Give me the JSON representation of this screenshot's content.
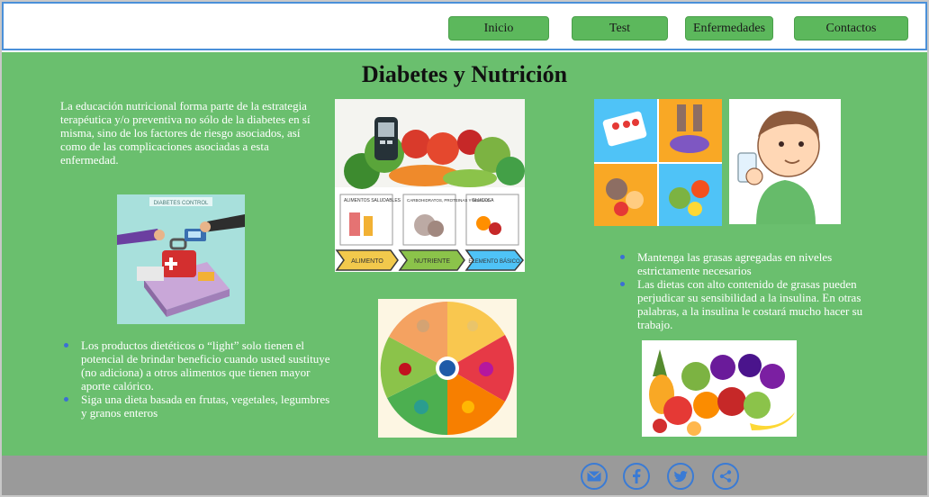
{
  "nav": {
    "items": [
      "Inicio",
      "Test",
      "Enfermedades",
      "Contactos"
    ]
  },
  "main": {
    "title": "Diabetes y Nutrición",
    "intro": "La educación nutricional forma  parte de la estrategia terapéutica y/o preventiva no sólo de la diabetes en sí misma, sino de los factores de riesgo asociados, así como de las complicaciones  asociadas a esta enfermedad.",
    "left_bullets": [
      "Los productos dietéticos o “light” solo tienen el potencial de brindar beneficio cuando usted sustituye (no adiciona) a otros alimentos que tienen mayor aporte calórico.",
      "Siga una dieta basada en frutas, vegetales, legumbres y granos enteros"
    ],
    "right_bullets": [
      "Mantenga las grasas agregadas en niveles estrictamente necesarios",
      " Las dietas con alto contenido de grasas pueden perjudicar su sensibilidad a la insulina. En otras palabras, a la insulina le costará mucho hacer su trabajo."
    ],
    "images": {
      "diabetes_control": {
        "label": "DIABETES CONTROL"
      },
      "food_groups": {
        "labels": [
          "ALIMENTOS SALUDABLES",
          "CARBOHIDRATOS, PROTEINAS Y GRASAS",
          "GLUCOSA"
        ],
        "arrows": [
          "ALIMENTO",
          "NUTRIENTE",
          "ELEMENTO BÁSICO"
        ]
      }
    }
  },
  "footer": {
    "icons": [
      "email-icon",
      "facebook-icon",
      "twitter-icon",
      "share-icon"
    ]
  },
  "colors": {
    "main_bg": "#6abf6e",
    "nav_btn": "#5cb85c",
    "footer_bg": "#9a9a9a",
    "header_border": "#4a90d9",
    "icon_blue": "#3a7bd5"
  }
}
